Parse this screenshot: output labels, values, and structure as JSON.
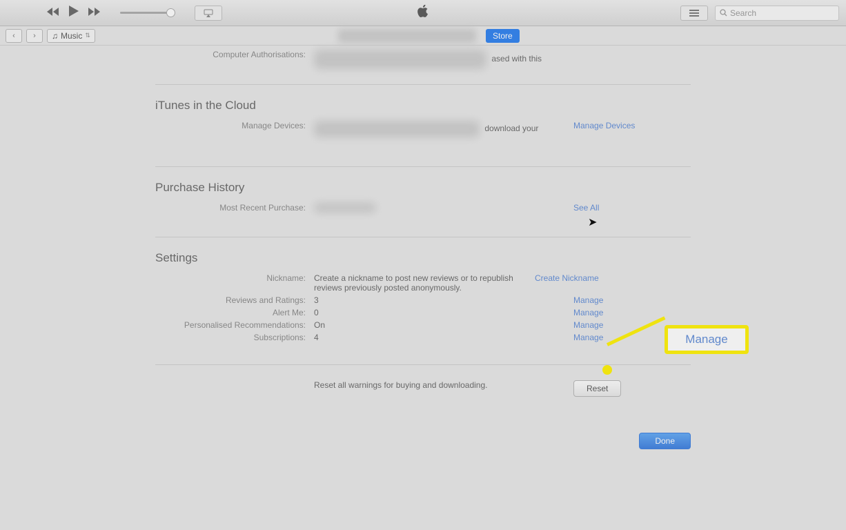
{
  "toolbar": {
    "search_placeholder": "Search"
  },
  "nav": {
    "media_label": "Music",
    "store_button": "Store"
  },
  "sections": {
    "auth": {
      "label": "Computer Authorisations:",
      "tail": "ased with this"
    },
    "cloud": {
      "title": "iTunes in the Cloud",
      "devices_label": "Manage Devices:",
      "tail": "download your",
      "link": "Manage Devices"
    },
    "purchase": {
      "title": "Purchase History",
      "recent_label": "Most Recent Purchase:",
      "link": "See All"
    },
    "settings": {
      "title": "Settings",
      "nickname_label": "Nickname:",
      "nickname_value": "Create a nickname to post new reviews or to republish reviews previously posted anonymously.",
      "nickname_link": "Create Nickname",
      "reviews_label": "Reviews and Ratings:",
      "reviews_value": "3",
      "reviews_link": "Manage",
      "alert_label": "Alert Me:",
      "alert_value": "0",
      "alert_link": "Manage",
      "rec_label": "Personalised Recommendations:",
      "rec_value": "On",
      "rec_link": "Manage",
      "subs_label": "Subscriptions:",
      "subs_value": "4",
      "subs_link": "Manage"
    },
    "reset_text": "Reset all warnings for buying and downloading.",
    "reset_button": "Reset",
    "done_button": "Done"
  },
  "callout": {
    "label": "Manage"
  }
}
